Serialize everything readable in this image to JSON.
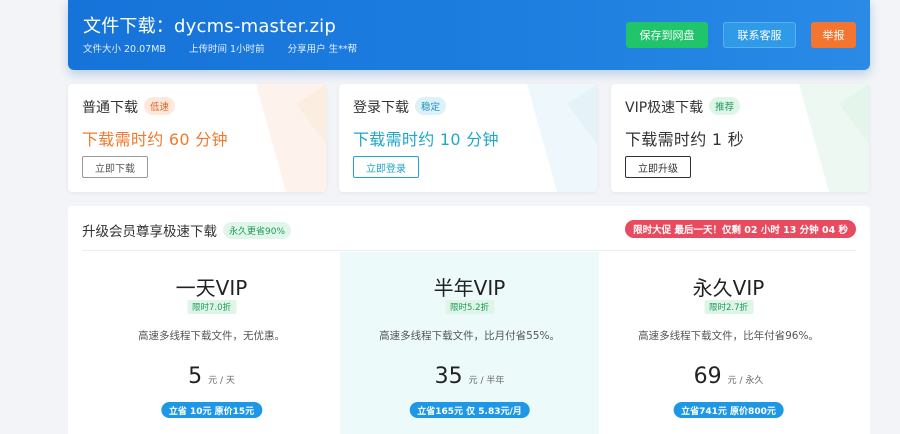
{
  "header": {
    "title": "文件下载：dycms-master.zip",
    "size_label": "文件大小",
    "size_value": "20.07MB",
    "upload_label": "上传时间",
    "upload_value": "1小时前",
    "share_label": "分享用户",
    "share_value": "生**帮",
    "save_button": "保存到网盘",
    "service_button": "联系客服",
    "report_button": "举报"
  },
  "cards": [
    {
      "name": "普通下载",
      "badge": "低速",
      "time": "下载需时约 60 分钟",
      "button": "立即下载",
      "color": "#f0792e",
      "badge_bg": "#fde9dc",
      "badge_color": "#e0642a"
    },
    {
      "name": "登录下载",
      "badge": "稳定",
      "time": "下载需时约 10 分钟",
      "button": "立即登录",
      "color": "#1fa6c9",
      "badge_bg": "#dcf1fa",
      "badge_color": "#1a8fb8"
    },
    {
      "name": "VIP极速下载",
      "badge": "推荐",
      "time": "下载需时约 1 秒",
      "button": "立即升级",
      "color": "#333333",
      "badge_bg": "#def5e7",
      "badge_color": "#1c9a57"
    }
  ],
  "vip": {
    "title": "升级会员尊享极速下载",
    "badge": "永久更省90%",
    "promo": "限时大促 最后一天！仅剩 02 小时 13 分钟 04 秒",
    "plans": [
      {
        "name": "一天VIP",
        "tag": "限时7.0折",
        "desc": "高速多线程下载文件，无优惠。",
        "price": "5",
        "unit": "元 / 天",
        "buy": "立省 10元 原价15元"
      },
      {
        "name": "半年VIP",
        "tag": "限时5.2折",
        "desc": "高速多线程下载文件，比月付省55%。",
        "price": "35",
        "unit": "元 / 半年",
        "buy": "立省165元 仅 5.83元/月"
      },
      {
        "name": "永久VIP",
        "tag": "限时2.7折",
        "desc": "高速多线程下载文件，比年付省96%。",
        "price": "69",
        "unit": "元 / 永久",
        "buy": "立省741元 原价800元"
      }
    ]
  }
}
